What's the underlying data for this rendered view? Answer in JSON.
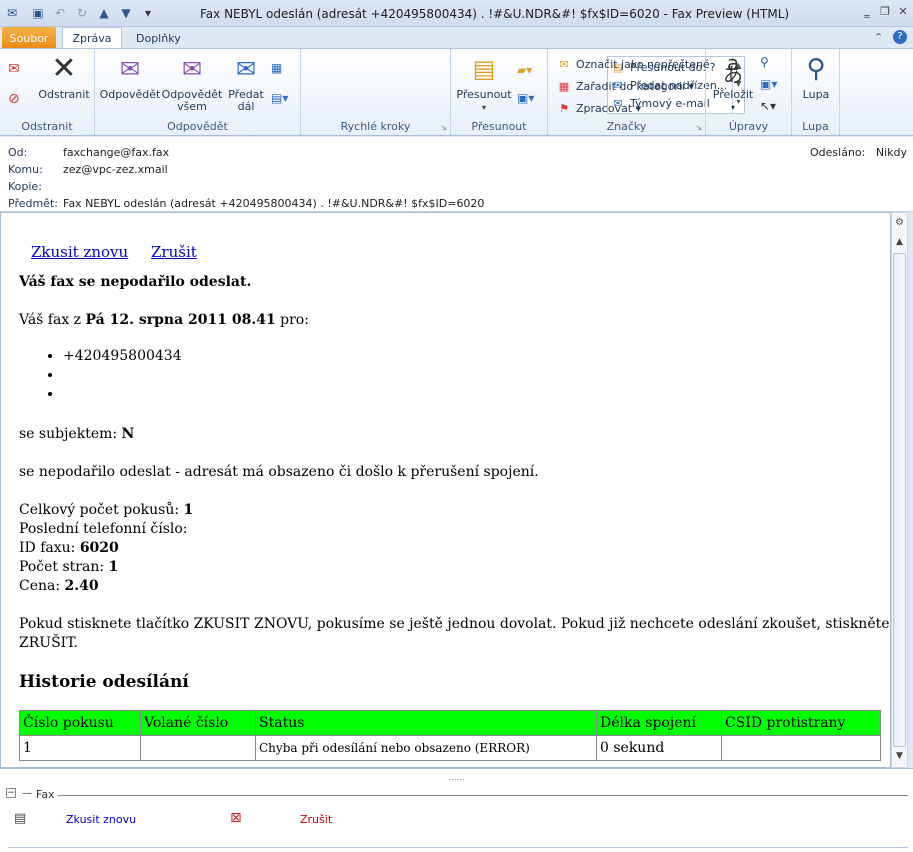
{
  "window": {
    "title": "Fax NEBYL odeslán (adresát  +420495800434)       . !#&U.NDR&#!  $fx$ID=6020  -  Fax Preview (HTML)",
    "help_icon": "?"
  },
  "tabs": {
    "file": "Soubor",
    "message": "Zpráva",
    "addins": "Doplňky"
  },
  "ribbon": {
    "delete_group": {
      "label": "Odstranit",
      "delete_btn": "Odstranit"
    },
    "respond_group": {
      "label": "Odpovědět",
      "reply": "Odpovědět",
      "reply_all_1": "Odpovědět",
      "reply_all_2": "všem",
      "forward_1": "Předat",
      "forward_2": "dál"
    },
    "quicksteps_group": {
      "label": "Rychlé kroky",
      "items": [
        "Přesunout do: ?",
        "Předat nadřízen...",
        "Týmový e-mail"
      ]
    },
    "move_group": {
      "label": "Přesunout",
      "move_btn": "Přesunout"
    },
    "tags_group": {
      "label": "Značky",
      "items": [
        "Označit jako nepřečtené",
        "Zařadit do kategorií",
        "Zpracovat"
      ]
    },
    "edit_group": {
      "label": "Úpravy",
      "translate_btn": "Přeložit"
    },
    "zoom_group": {
      "label": "Lupa",
      "zoom_btn": "Lupa"
    }
  },
  "header": {
    "from_label": "Od:",
    "from": "faxchange@fax.fax",
    "to_label": "Komu:",
    "to": "zez@vpc-zez.xmail",
    "cc_label": "Kopie:",
    "cc": "",
    "subject_label": "Předmět:",
    "subject": "Fax NEBYL odeslán (adresát  +420495800434)       . !#&U.NDR&#!  $fx$ID=6020",
    "sent_label": "Odesláno:",
    "sent": "Nikdy"
  },
  "body": {
    "retry_link": "Zkusit znovu",
    "cancel_link": "Zrušit",
    "headline": "Váš fax se nepodařilo odeslat.",
    "fax_from_prefix": "Váš fax z ",
    "fax_date": "Pá 12. srpna 2011 08.41",
    "fax_from_suffix": " pro:",
    "recipients": [
      "+420495800434",
      "",
      ""
    ],
    "subject_prefix": "se subjektem: ",
    "subject_value": "N",
    "failure_text": "se nepodařilo odeslat - adresát má obsazeno či došlo k přerušení spojení.",
    "attempts_label": "Celkový počet pokusů: ",
    "attempts_value": "1",
    "last_number_label": "Poslední telefonní číslo:",
    "fax_id_label": "ID faxu: ",
    "fax_id_value": "6020",
    "pages_label": "Počet stran: ",
    "pages_value": "1",
    "price_label": "Cena: ",
    "price_value": "2.40",
    "instructions_1": "Pokud stisknete tlačítko ZKUSIT ZNOVU, pokusíme se ještě jednou dovolat. Pokud již nechcete odeslání zkoušet, stiskněte",
    "instructions_2": "ZRUŠIT.",
    "history_heading": "Historie odesílání",
    "history_columns": [
      "Číslo pokusu",
      "Volané číslo",
      "Status",
      "Délka spojení",
      "CSID protistrany"
    ],
    "history_rows": [
      [
        "1",
        "",
        "Chyba při odesílání nebo obsazeno (ERROR)",
        "0 sekund",
        ""
      ]
    ]
  },
  "fax_pane": {
    "label": "Fax",
    "retry": "Zkusit znovu",
    "cancel": "Zrušit"
  }
}
